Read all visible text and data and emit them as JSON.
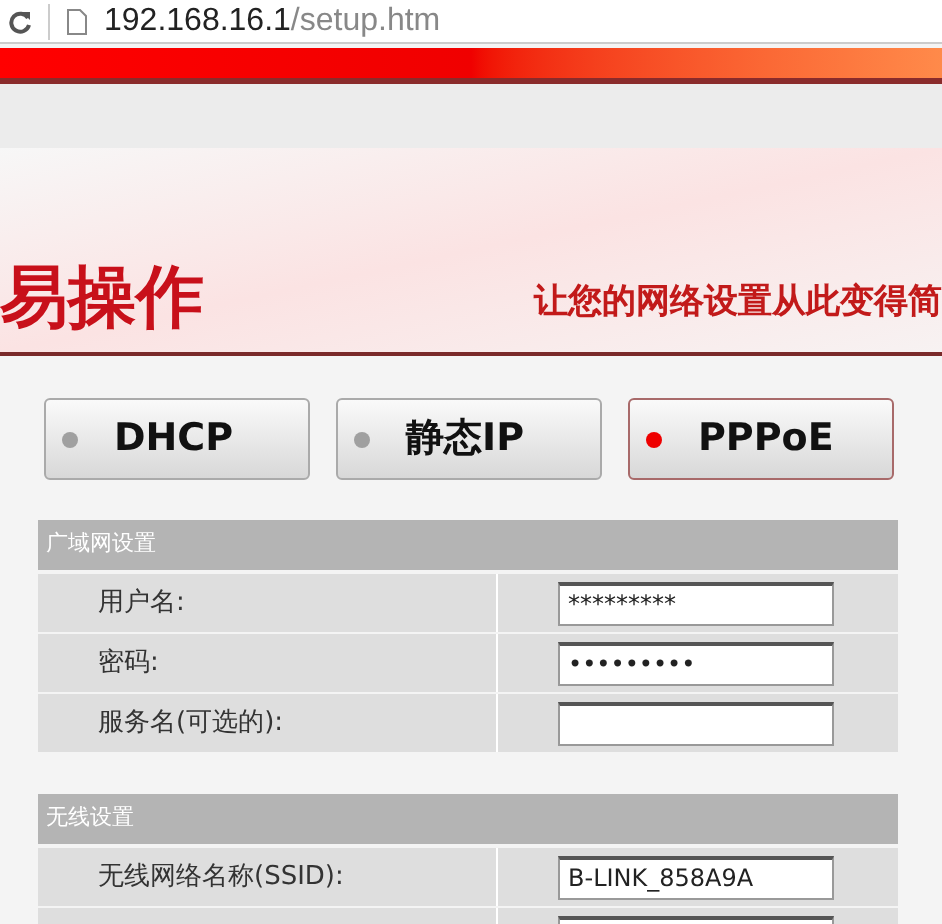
{
  "address_bar": {
    "host": "192.168.16.1",
    "path": "/setup.htm"
  },
  "banner": {
    "title": "易操作",
    "tagline": "让您的网络设置从此变得简"
  },
  "modes": [
    {
      "label": "DHCP",
      "selected": false
    },
    {
      "label": "静态IP",
      "selected": false
    },
    {
      "label": "PPPoE",
      "selected": true
    }
  ],
  "sections": [
    {
      "title": "广域网设置",
      "rows": [
        {
          "label": "用户名:",
          "value": "*********"
        },
        {
          "label": "密码:",
          "value": "•••••••••"
        },
        {
          "label": "服务名(可选的):"
        }
      ]
    },
    {
      "title": "无线设置",
      "rows": [
        {
          "label": "无线网络名称(SSID):",
          "value": "B-LINK_858A9A"
        },
        {}
      ]
    }
  ]
}
